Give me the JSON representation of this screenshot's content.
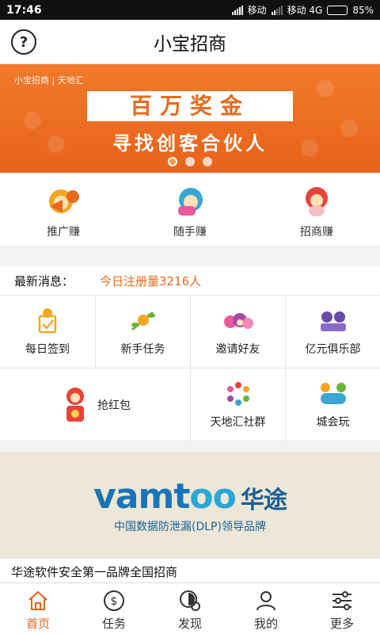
{
  "status_bar": {
    "time": "17:46",
    "carrier1": "移动",
    "carrier2": "移动 4G",
    "battery": "85%",
    "battery_level": 0.85
  },
  "header": {
    "title": "小宝招商",
    "help_icon": "question-circle-icon"
  },
  "banner": {
    "brand": "小宝招商 | 天地汇",
    "line1": "百万奖金",
    "line2": "寻找创客合伙人",
    "pages": 3,
    "active_page": 1
  },
  "quick_actions": [
    {
      "label": "推广赚",
      "icon": "monkey-megaphone-icon"
    },
    {
      "label": "随手赚",
      "icon": "monkey-gamepad-icon"
    },
    {
      "label": "招商赚",
      "icon": "monkey-moneybag-icon"
    }
  ],
  "news": {
    "label": "最新消息：",
    "value": "今日注册量3216人"
  },
  "features": [
    {
      "label": "每日签到",
      "icon": "checkin-clipboard-icon"
    },
    {
      "label": "新手任务",
      "icon": "monkey-branch-icon"
    },
    {
      "label": "邀请好友",
      "icon": "monkey-friends-icon"
    },
    {
      "label": "亿元俱乐部",
      "icon": "club-monkeys-icon"
    },
    {
      "label": "抢红包",
      "icon": "red-envelope-monkey-icon"
    },
    {
      "label": "天地汇社群",
      "icon": "community-circle-icon"
    },
    {
      "label": "城会玩",
      "icon": "gamepad-monkeys-icon"
    }
  ],
  "ad": {
    "logo_a": "vamt",
    "logo_b": "oo",
    "logo_cn": "华途",
    "subtitle": "中国数据防泄漏(DLP)领导品牌",
    "caption": "华途软件安全第一品牌全国招商"
  },
  "colors": {
    "accent": "#e8621a",
    "banner": "#f07b2a",
    "ad_bg": "#ece7d6"
  },
  "tabs": [
    {
      "label": "首页",
      "icon": "home-icon",
      "active": true
    },
    {
      "label": "任务",
      "icon": "dollar-circle-icon",
      "active": false
    },
    {
      "label": "发现",
      "icon": "discover-icon",
      "active": false
    },
    {
      "label": "我的",
      "icon": "user-icon",
      "active": false
    },
    {
      "label": "更多",
      "icon": "sliders-icon",
      "active": false
    }
  ]
}
